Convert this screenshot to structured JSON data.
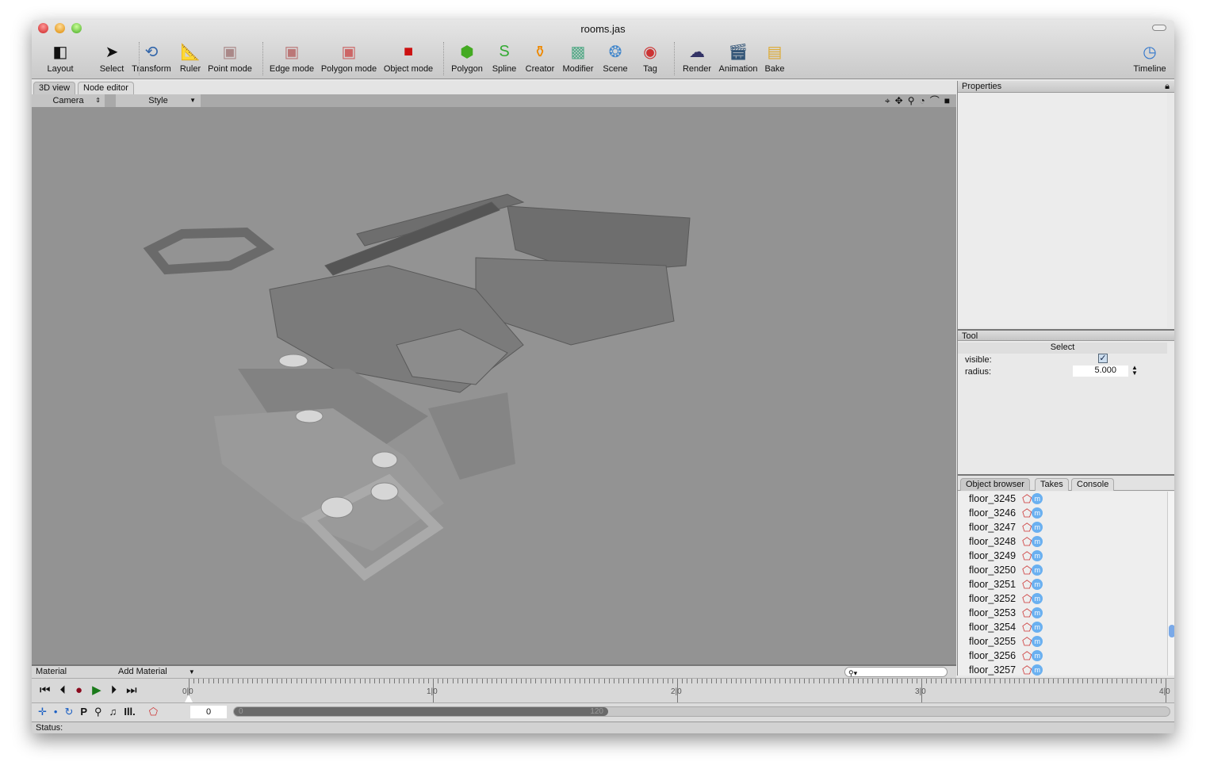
{
  "window": {
    "title": "rooms.jas"
  },
  "toolbar": [
    {
      "id": "layout",
      "label": "Layout",
      "icon": "layout-icon"
    },
    {
      "id": "select",
      "label": "Select",
      "icon": "arrow-cursor-icon"
    },
    {
      "id": "transform",
      "label": "Transform",
      "icon": "transform-icon"
    },
    {
      "id": "ruler",
      "label": "Ruler",
      "icon": "ruler-icon"
    },
    {
      "id": "point-mode",
      "label": "Point mode",
      "icon": "point-mode-icon"
    },
    {
      "id": "edge-mode",
      "label": "Edge mode",
      "icon": "edge-mode-icon"
    },
    {
      "id": "polygon-mode",
      "label": "Polygon mode",
      "icon": "polygon-mode-icon"
    },
    {
      "id": "object-mode",
      "label": "Object mode",
      "icon": "object-mode-icon"
    },
    {
      "id": "polygon",
      "label": "Polygon",
      "icon": "polygon-primitive-icon"
    },
    {
      "id": "spline",
      "label": "Spline",
      "icon": "spline-icon"
    },
    {
      "id": "creator",
      "label": "Creator",
      "icon": "creator-icon"
    },
    {
      "id": "modifier",
      "label": "Modifier",
      "icon": "modifier-icon"
    },
    {
      "id": "scene",
      "label": "Scene",
      "icon": "scene-icon"
    },
    {
      "id": "tag",
      "label": "Tag",
      "icon": "tag-icon"
    },
    {
      "id": "render",
      "label": "Render",
      "icon": "render-icon"
    },
    {
      "id": "animation",
      "label": "Animation",
      "icon": "animation-icon"
    },
    {
      "id": "bake",
      "label": "Bake",
      "icon": "bake-icon"
    },
    {
      "id": "timeline",
      "label": "Timeline",
      "icon": "timeline-clock-icon"
    }
  ],
  "view_tabs": [
    "3D view",
    "Node editor"
  ],
  "viewport": {
    "camera_label": "Camera",
    "style_label": "Style"
  },
  "properties": {
    "title": "Properties"
  },
  "tool": {
    "title": "Tool",
    "name": "Select",
    "visible_label": "visible:",
    "visible": true,
    "radius_label": "radius:",
    "radius": "5.000"
  },
  "object_browser": {
    "tabs": [
      "Object browser",
      "Takes",
      "Console"
    ],
    "items": [
      "floor_3245",
      "floor_3246",
      "floor_3247",
      "floor_3248",
      "floor_3249",
      "floor_3250",
      "floor_3251",
      "floor_3252",
      "floor_3253",
      "floor_3254",
      "floor_3255",
      "floor_3256",
      "floor_3257"
    ]
  },
  "material": {
    "label": "Material",
    "add_label": "Add Material"
  },
  "timeline": {
    "ticks": [
      "0|0",
      "1|0",
      "2|0",
      "3|0",
      "4|0"
    ],
    "frame": "0",
    "range_start": "0",
    "range_end": "120"
  },
  "status": {
    "label": "Status:"
  }
}
